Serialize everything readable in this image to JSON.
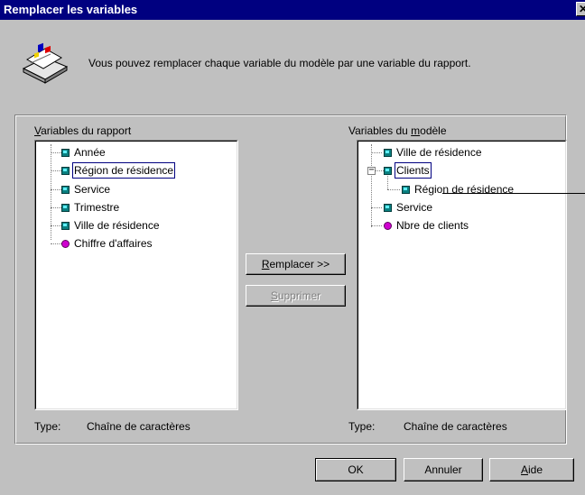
{
  "dialog": {
    "title": "Remplacer les variables",
    "close_glyph": "✕",
    "intro": "Vous pouvez remplacer chaque variable du modèle par une variable du rapport."
  },
  "left": {
    "label_prefix": "V",
    "label_rest": "ariables du rapport",
    "items": [
      {
        "label": "Année",
        "icon": "dimension-cube-icon"
      },
      {
        "label": "Région de résidence",
        "icon": "dimension-cube-icon"
      },
      {
        "label": "Service",
        "icon": "dimension-cube-icon"
      },
      {
        "label": "Trimestre",
        "icon": "dimension-cube-icon"
      },
      {
        "label": "Ville de résidence",
        "icon": "dimension-cube-icon"
      },
      {
        "label": "Chiffre d'affaires",
        "icon": "indicator-dot-icon"
      }
    ],
    "type_label": "Type:",
    "type_value": "Chaîne de caractères"
  },
  "right": {
    "label_a": "Variables du ",
    "label_u": "m",
    "label_b": "odèle",
    "items": [
      {
        "label": "Ville de résidence",
        "icon": "dimension-cube-icon"
      },
      {
        "label": "Clients",
        "icon": "dimension-cube-icon"
      },
      {
        "label": "Région de résidence",
        "icon": "dimension-cube-icon"
      },
      {
        "label": "Service",
        "icon": "dimension-cube-icon"
      },
      {
        "label": "Nbre de clients",
        "icon": "indicator-dot-icon"
      }
    ],
    "collapse_glyph": "−",
    "type_label": "Type:",
    "type_value": "Chaîne de caractères"
  },
  "buttons": {
    "replace_u": "R",
    "replace_rest": "emplacer >>",
    "delete_u": "S",
    "delete_rest": "upprimer",
    "ok": "OK",
    "cancel": "Annuler",
    "help_u": "A",
    "help_rest": "ide"
  },
  "colors": {
    "titlebar": "#000080",
    "face": "#c0c0c0",
    "dimension_icon": "#0a8080",
    "indicator_icon": "#d000d0"
  }
}
